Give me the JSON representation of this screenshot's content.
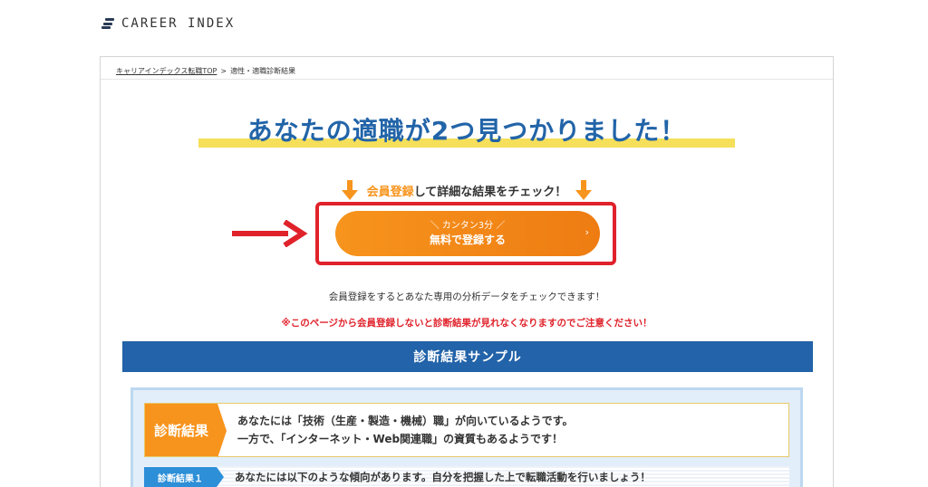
{
  "logo": {
    "text": "CAREER INDEX"
  },
  "breadcrumb": {
    "home": "キャリアインデックス転職TOP",
    "separator": ">",
    "current": "適性・適職診断結果"
  },
  "headline": "あなたの適職が2つ見つかりました！",
  "cta": {
    "accent": "会員登録",
    "rest": "して詳細な結果をチェック！"
  },
  "register_button": {
    "sub": "＼ カンタン3分 ／",
    "main": "無料で登録する",
    "chevron": "›"
  },
  "info_text": "会員登録をするとあなた専用の分析データをチェックできます！",
  "warning_text": "※このページから会員登録しないと診断結果が見れなくなりますのでご注意ください！",
  "sample": {
    "title": "診断結果サンプル",
    "tag": "診断結果",
    "line1": "あなたには「技術（生産・製造・機械）職」が向いているようです。",
    "line2": "一方で、「インターネット・Web関連職」の資質もあるようです！",
    "row2_tag": "診断結果１",
    "row2_text": "あなたには以下のような傾向があります。自分を把握した上で転職活動を行いましょう！"
  },
  "colors": {
    "accent": "#f7941d",
    "headline": "#2264a8",
    "highlight_red": "#e0222b",
    "bar_blue": "#2263a9"
  },
  "icons": {
    "logo": "career-index-logo-icon",
    "down_arrow": "down-arrow-icon",
    "pointer_arrow": "right-arrow-icon"
  }
}
